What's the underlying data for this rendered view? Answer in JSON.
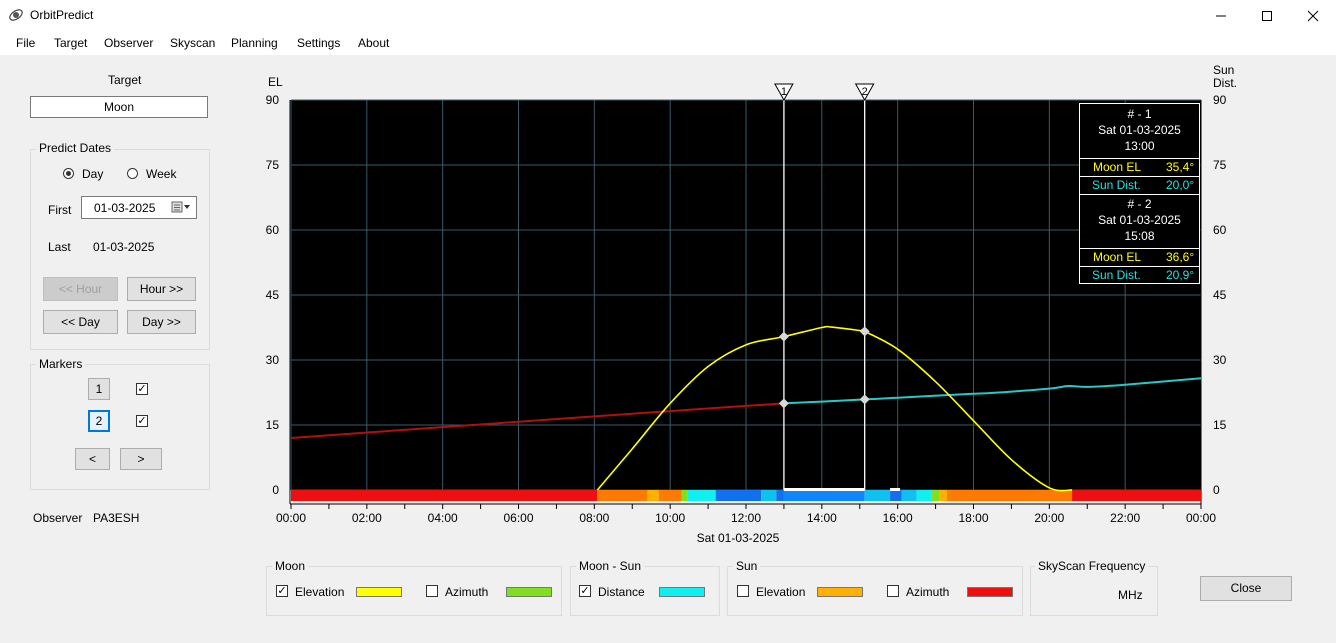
{
  "window": {
    "title": "OrbitPredict"
  },
  "menu": [
    "File",
    "Target",
    "Observer",
    "Skyscan",
    "Planning",
    "Settings",
    "About"
  ],
  "left": {
    "target_label": "Target",
    "target_value": "Moon",
    "predict_dates_label": "Predict Dates",
    "radio_day": "Day",
    "radio_week": "Week",
    "selected_period": "Day",
    "first_label": "First",
    "first_value": "01-03-2025",
    "last_label": "Last",
    "last_value": "01-03-2025",
    "btn_prev_hour": "<< Hour",
    "btn_next_hour": "Hour >>",
    "btn_prev_day": "<< Day",
    "btn_next_day": "Day >>",
    "markers_label": "Markers",
    "marker1": "1",
    "marker2": "2",
    "marker1_checked": true,
    "marker2_checked": true,
    "btn_prev": "<",
    "btn_next": ">",
    "observer_label": "Observer",
    "observer_value": "PA3ESH"
  },
  "chart": {
    "left_axis_title": "EL",
    "right_axis_title_1": "Sun",
    "right_axis_title_2": "Dist.",
    "y_ticks": [
      "90",
      "75",
      "60",
      "45",
      "30",
      "15",
      "0"
    ],
    "x_ticks": [
      "00:00",
      "02:00",
      "04:00",
      "06:00",
      "08:00",
      "10:00",
      "12:00",
      "14:00",
      "16:00",
      "18:00",
      "20:00",
      "22:00",
      "00:00"
    ],
    "x_date": "Sat 01-03-2025",
    "marker_labels": [
      "1",
      "2"
    ],
    "colors": {
      "moon_el": "#ffff00",
      "sun_dist_day": "#28c8c8",
      "sun_dist_night": "#b01010",
      "grid": "#3a5a6a"
    }
  },
  "chart_data": {
    "type": "line",
    "xlabel": "",
    "x_range_hours": [
      0,
      24
    ],
    "ylim": [
      0,
      90
    ],
    "series": [
      {
        "name": "Moon EL",
        "x": [
          8.08,
          9,
          10,
          11,
          12,
          13,
          14,
          14.25,
          15,
          15.13,
          16,
          17,
          18,
          19,
          20,
          20.6
        ],
        "values": [
          0,
          9.5,
          20,
          28.5,
          33.5,
          35.4,
          37.5,
          37.6,
          36.8,
          36.6,
          32.5,
          25,
          16,
          7,
          0.5,
          0
        ]
      },
      {
        "name": "Sun Dist.",
        "x": [
          0,
          4,
          8,
          10,
          12,
          13,
          14,
          15.13,
          16,
          18,
          18.5,
          20,
          20.5,
          21,
          22,
          24
        ],
        "values": [
          12,
          14.5,
          17,
          18.2,
          19.4,
          20.0,
          20.4,
          20.9,
          21.3,
          22.2,
          22.4,
          23.4,
          24.0,
          23.8,
          24.3,
          25.8
        ]
      }
    ]
  },
  "info_box": {
    "m1_header": "# - 1",
    "m1_date": "Sat 01-03-2025",
    "m1_time": "13:00",
    "m1_moon_label": "Moon EL",
    "m1_moon_value": "35,4°",
    "m1_sun_label": "Sun Dist.",
    "m1_sun_value": "20,0°",
    "m2_header": "# - 2",
    "m2_date": "Sat 01-03-2025",
    "m2_time": "15:08",
    "m2_moon_label": "Moon EL",
    "m2_moon_value": "36,6°",
    "m2_sun_label": "Sun Dist.",
    "m2_sun_value": "20,9°"
  },
  "legend": {
    "moon_label": "Moon",
    "moon_elevation": "Elevation",
    "moon_azimuth": "Azimuth",
    "moon_sun_label": "Moon  - Sun",
    "distance": "Distance",
    "sun_label": "Sun",
    "sun_elevation": "Elevation",
    "sun_azimuth": "Azimuth",
    "skyscan_label": "SkyScan Frequency",
    "mhz": "MHz",
    "close": "Close",
    "colors": {
      "moon_el": "#ffff00",
      "moon_az": "#80e020",
      "distance": "#10f0f0",
      "sun_el": "#ffb000",
      "sun_az": "#ee1010"
    }
  }
}
